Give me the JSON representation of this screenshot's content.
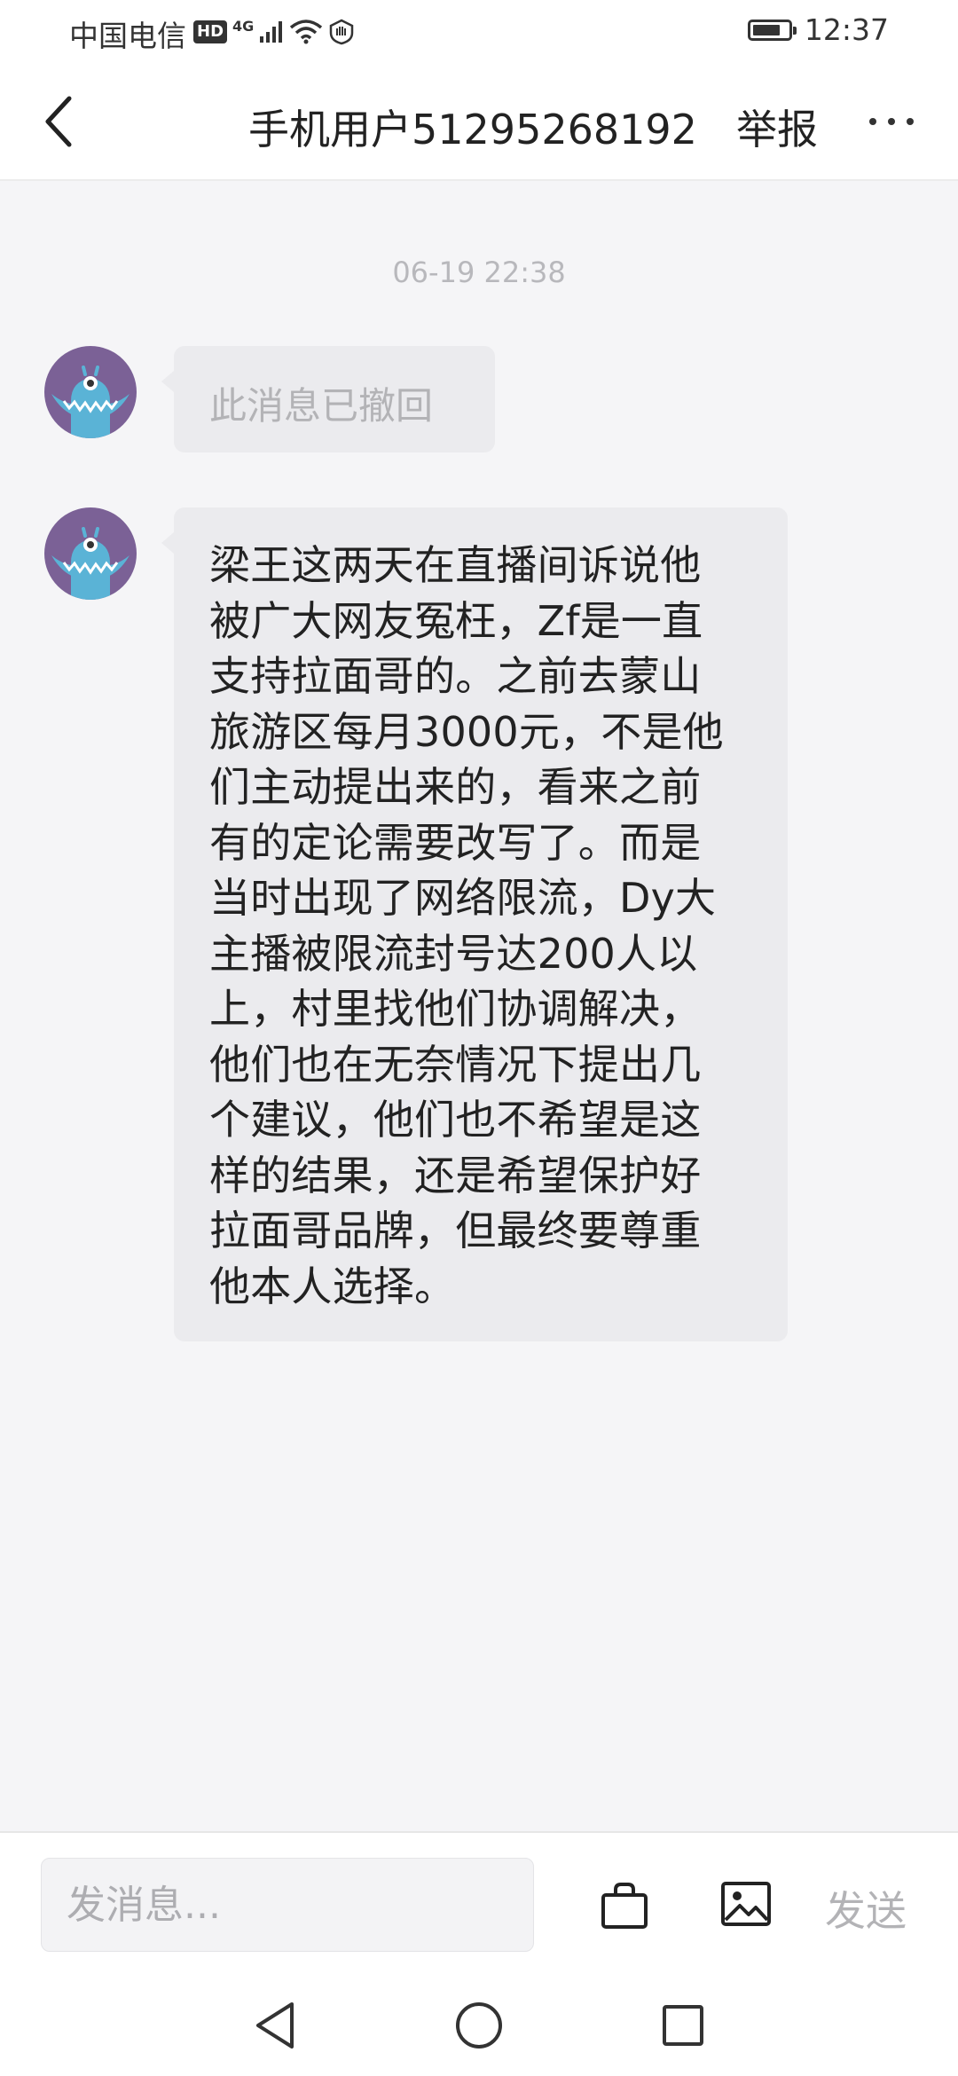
{
  "status_bar": {
    "carrier": "中国电信",
    "hd": "HD",
    "network": "4G",
    "battery_level": 0.8,
    "time": "12:37"
  },
  "header": {
    "title": "手机用户51295268192",
    "report_label": "举报"
  },
  "chat": {
    "timestamp": "06-19 22:38",
    "messages": [
      {
        "text": "此消息已撤回",
        "recalled": true
      },
      {
        "text": "梁王这两天在直播间诉说他\n被广大网友冤枉，Zf是一直\n支持拉面哥的。之前去蒙山\n旅游区每月3000元，不是他\n们主动提出来的，看来之前\n有的定论需要改写了。而是\n当时出现了网络限流，Dy大\n主播被限流封号达200人以\n上，村里找他们协调解决，\n他们也在无奈情况下提出几\n个建议，他们也不希望是这\n样的结果，还是希望保护好\n拉面哥品牌，但最终要尊重\n他本人选择。",
        "recalled": false
      }
    ]
  },
  "input_bar": {
    "placeholder": "发消息...",
    "send_label": "发送"
  },
  "colors": {
    "avatar_bg": "#7b6196",
    "avatar_monster": "#5ab3d6",
    "bubble_bg": "#ebebee",
    "chat_bg": "#f5f5f7"
  },
  "icons": [
    "back-icon",
    "more-icon",
    "wifi-icon",
    "signal-icon",
    "battery-icon",
    "shopping-bag-icon",
    "image-icon",
    "nav-back-icon",
    "nav-home-icon",
    "nav-recents-icon"
  ]
}
